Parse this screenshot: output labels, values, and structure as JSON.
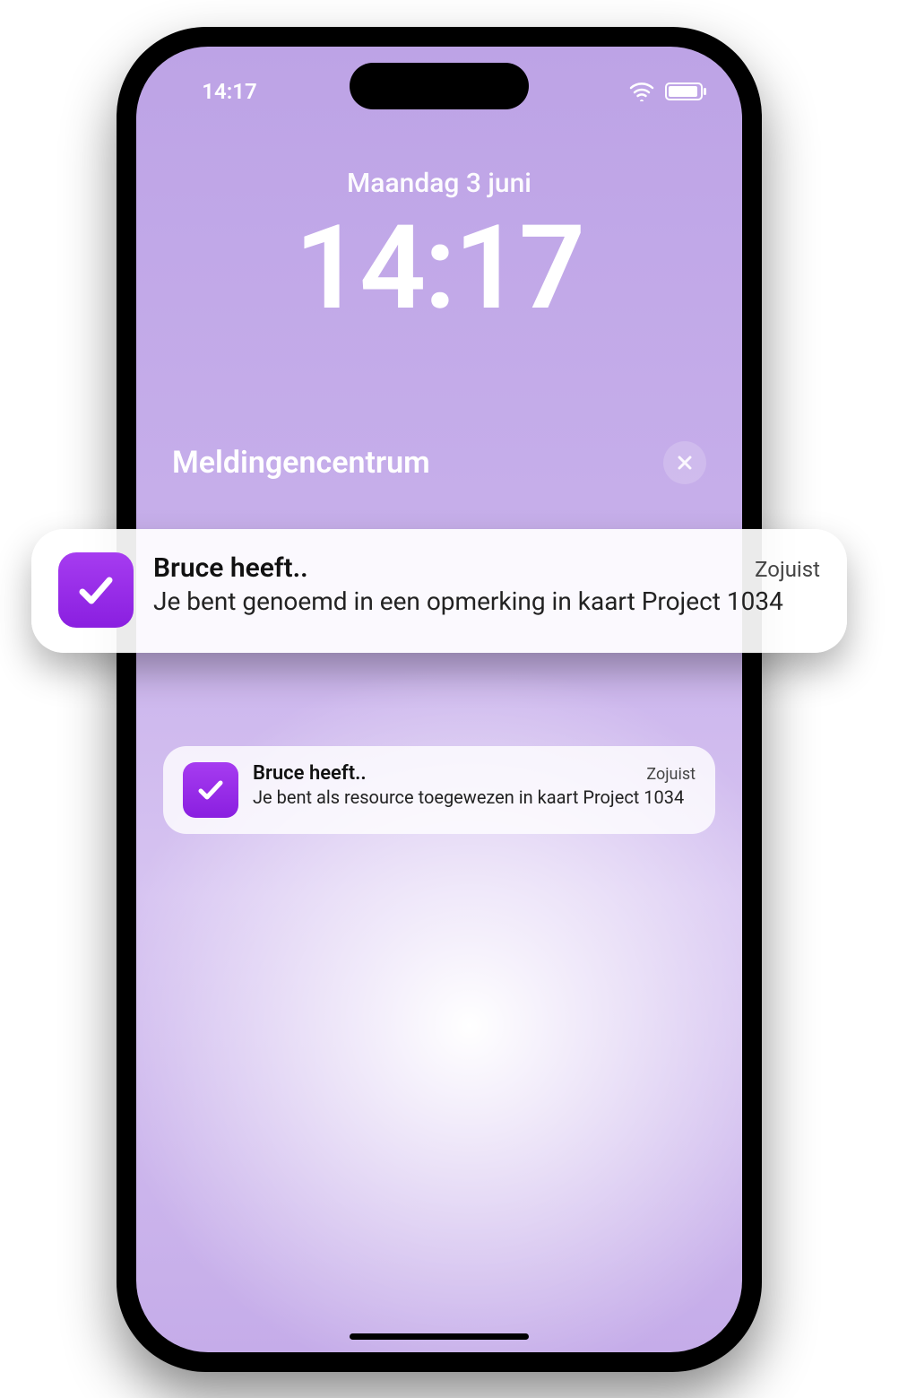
{
  "status_bar": {
    "time": "14:17"
  },
  "lock_screen": {
    "date": "Maandag 3 juni",
    "time": "14:17"
  },
  "notification_center": {
    "title": "Meldingencentrum"
  },
  "notifications": [
    {
      "app_icon": "checkmark-icon",
      "title": "Bruce heeft..",
      "time": "Zojuist",
      "body": "Je bent genoemd in een opmerking in kaart Project 1034"
    },
    {
      "app_icon": "checkmark-icon",
      "title": "Bruce heeft..",
      "time": "Zojuist",
      "body": "Je bent als resource toegewezen in kaart Project 1034"
    }
  ]
}
